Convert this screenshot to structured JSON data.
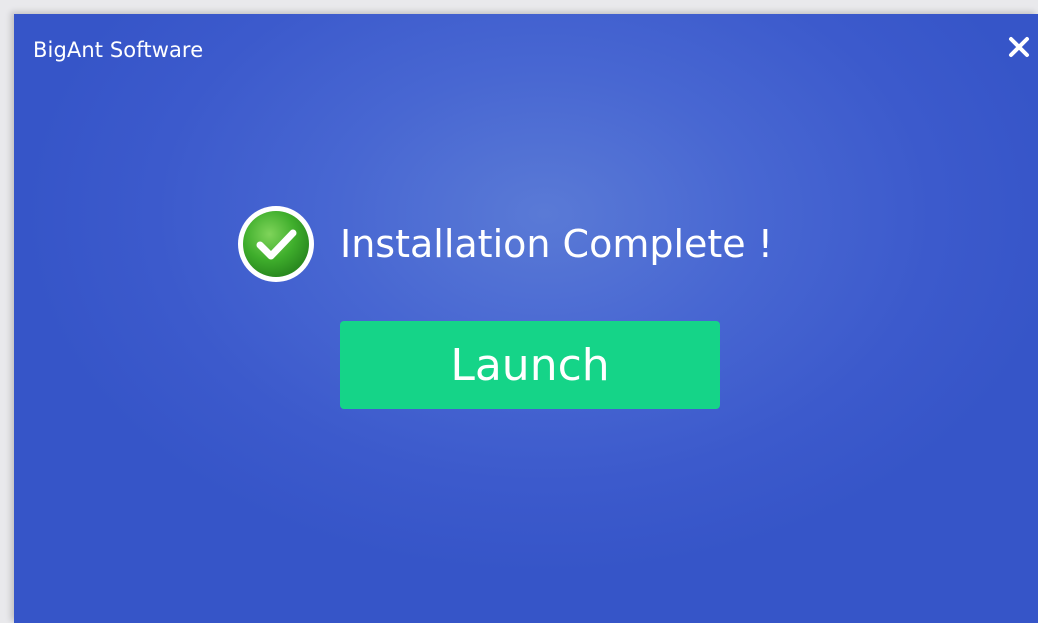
{
  "window": {
    "title": "BigAnt Software",
    "close_icon": "close-icon"
  },
  "status": {
    "icon": "check-circle-icon",
    "message": "Installation Complete !"
  },
  "actions": {
    "launch_label": "Launch"
  },
  "colors": {
    "background": "#4867d2",
    "button": "#15d488",
    "check": "#3aab2f",
    "text": "#ffffff"
  }
}
